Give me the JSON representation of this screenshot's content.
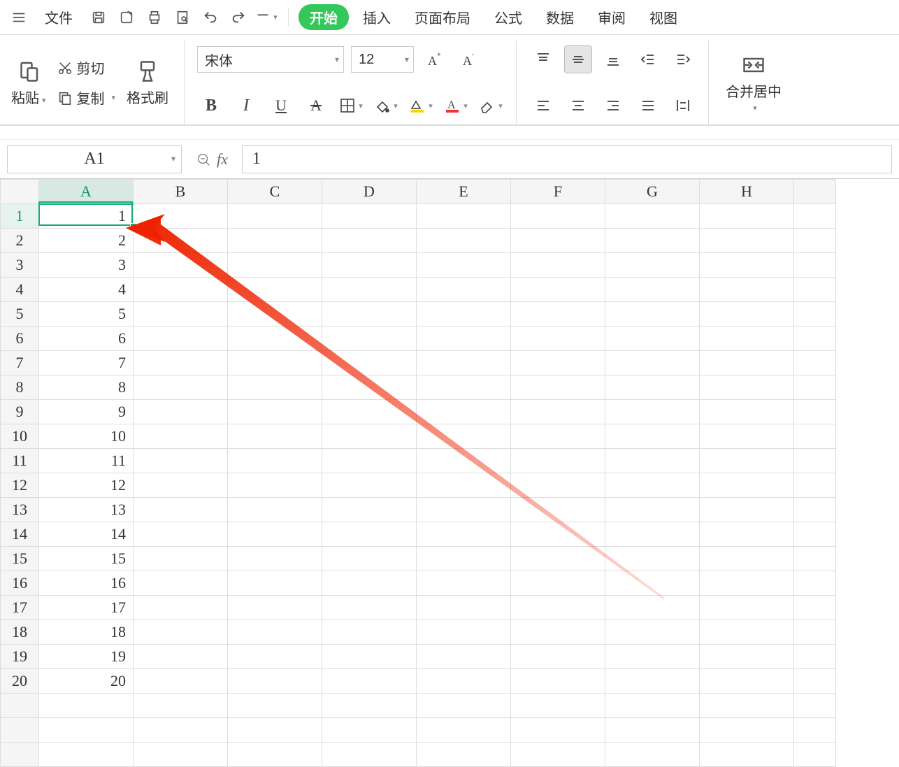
{
  "menu": {
    "file": "文件",
    "tabs": [
      "开始",
      "插入",
      "页面布局",
      "公式",
      "数据",
      "审阅",
      "视图"
    ],
    "active_tab_index": 0
  },
  "ribbon": {
    "paste": "粘贴",
    "cut": "剪切",
    "copy": "复制",
    "format_painter": "格式刷",
    "font_name": "宋体",
    "font_size": "12",
    "merge_center": "合并居中"
  },
  "formula_bar": {
    "name_box": "A1",
    "fx": "fx",
    "formula": "1"
  },
  "grid": {
    "columns": [
      "A",
      "B",
      "C",
      "D",
      "E",
      "F",
      "G",
      "H"
    ],
    "rows": [
      1,
      2,
      3,
      4,
      5,
      6,
      7,
      8,
      9,
      10,
      11,
      12,
      13,
      14,
      15,
      16,
      17,
      18,
      19,
      20
    ],
    "col_a_values": [
      1,
      2,
      3,
      4,
      5,
      6,
      7,
      8,
      9,
      10,
      11,
      12,
      13,
      14,
      15,
      16,
      17,
      18,
      19,
      20
    ],
    "selected_cell": "A1"
  }
}
